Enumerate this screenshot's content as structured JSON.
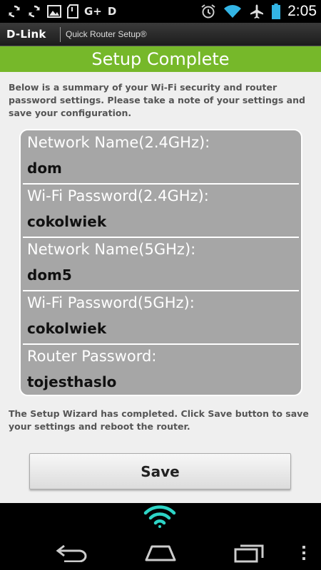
{
  "status_bar": {
    "left_icons": [
      "sync-icon",
      "sync-icon",
      "image-icon",
      "sd-card-icon",
      "google-plus-icon",
      "d-app-icon"
    ],
    "google_plus_label": "G+",
    "d_label": "D",
    "right_icons": [
      "alarm-icon",
      "wifi-icon",
      "airplane-icon",
      "battery-icon"
    ],
    "time": "2:05"
  },
  "app_header": {
    "logo": "D-Link",
    "subtitle": "Quick Router Setup®"
  },
  "title": "Setup Complete",
  "intro_text": "Below is a summary of your Wi-Fi security and router password settings. Please take a note of your settings and save your configuration.",
  "settings": [
    {
      "label": "Network Name(2.4GHz):",
      "value": "dom"
    },
    {
      "label": "Wi-Fi Password(2.4GHz):",
      "value": "cokolwiek"
    },
    {
      "label": "Network Name(5GHz):",
      "value": "dom5"
    },
    {
      "label": "Wi-Fi Password(5GHz):",
      "value": "cokolwiek"
    },
    {
      "label": "Router Password:",
      "value": "tojesthaslo"
    }
  ],
  "footer_text": "The Setup Wizard has completed. Click Save button to save your settings and reboot the router.",
  "save_button_label": "Save",
  "nav_bar": {
    "icons": [
      "wifi-icon",
      "back-icon",
      "home-icon",
      "recent-apps-icon",
      "menu-icon"
    ]
  },
  "colors": {
    "accent_green": "#76b82a",
    "settings_bg": "#a6a6a6",
    "page_bg": "#efefef",
    "wifi_teal": "#2dd4c6"
  }
}
